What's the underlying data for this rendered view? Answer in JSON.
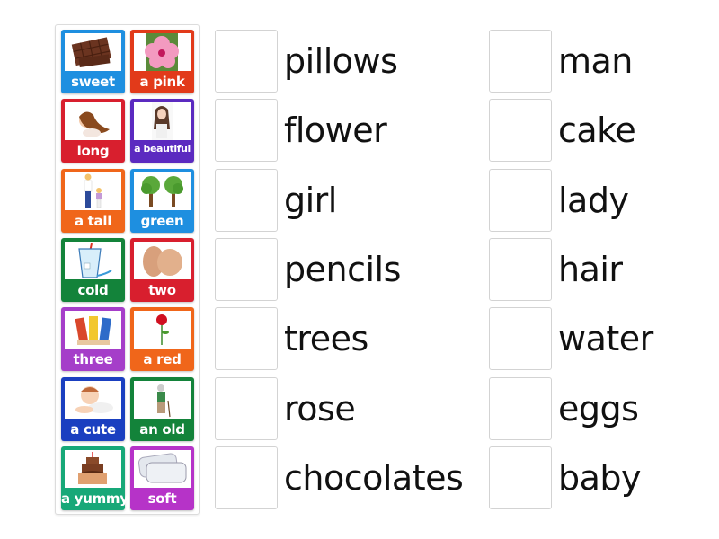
{
  "tiles": [
    {
      "label": "sweet",
      "color": "#1e8fe0",
      "image": "chocolate-bar"
    },
    {
      "label": "a pink",
      "color": "#e23a1a",
      "image": "pink-hibiscus-flower"
    },
    {
      "label": "long",
      "color": "#d81f2e",
      "image": "girl-long-hair"
    },
    {
      "label": "a beautiful",
      "color": "#5b2ac0",
      "image": "beautiful-lady"
    },
    {
      "label": "a tall",
      "color": "#f0661a",
      "image": "tall-man-and-child"
    },
    {
      "label": "green",
      "color": "#1e8fe0",
      "image": "two-trees"
    },
    {
      "label": "cold",
      "color": "#13833a",
      "image": "glass-of-water"
    },
    {
      "label": "two",
      "color": "#d81f2e",
      "image": "two-eggs"
    },
    {
      "label": "three",
      "color": "#a53ec9",
      "image": "three-pencils"
    },
    {
      "label": "a red",
      "color": "#f0661a",
      "image": "red-rose"
    },
    {
      "label": "a cute",
      "color": "#1a3fc0",
      "image": "baby"
    },
    {
      "label": "an old",
      "color": "#13833a",
      "image": "old-woman"
    },
    {
      "label": "a yummy",
      "color": "#17a878",
      "image": "cake"
    },
    {
      "label": "soft",
      "color": "#b633c8",
      "image": "pillows"
    }
  ],
  "left_words": [
    "pillows",
    "flower",
    "girl",
    "pencils",
    "trees",
    "rose",
    "chocolates"
  ],
  "right_words": [
    "man",
    "cake",
    "lady",
    "hair",
    "water",
    "eggs",
    "baby"
  ]
}
